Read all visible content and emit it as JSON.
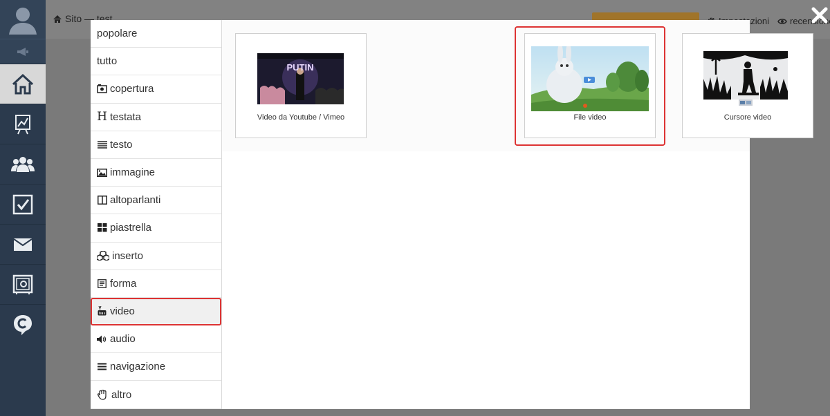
{
  "app_sidebar": {
    "items": [
      {
        "icon": "user-icon"
      },
      {
        "icon": "megaphone-icon"
      },
      {
        "icon": "home-icon"
      },
      {
        "icon": "chart-icon"
      },
      {
        "icon": "users-icon"
      },
      {
        "icon": "checkbox-icon"
      },
      {
        "icon": "mail-icon"
      },
      {
        "icon": "safe-icon"
      },
      {
        "icon": "chat-icon"
      }
    ]
  },
  "topbar": {
    "breadcrumb": "Sito — test",
    "settings_label": "Impostazioni",
    "review_label": "recensione"
  },
  "modal": {
    "categories": [
      {
        "label": "popolare",
        "icon": ""
      },
      {
        "label": "tutto",
        "icon": ""
      },
      {
        "label": "copertura",
        "icon": "camera-icon"
      },
      {
        "label": "testata",
        "icon": "header-icon"
      },
      {
        "label": "testo",
        "icon": "text-lines-icon"
      },
      {
        "label": "immagine",
        "icon": "image-icon"
      },
      {
        "label": "altoparlanti",
        "icon": "columns-icon"
      },
      {
        "label": "piastrella",
        "icon": "tiles-icon"
      },
      {
        "label": "inserto",
        "icon": "cubes-icon"
      },
      {
        "label": "forma",
        "icon": "form-icon"
      },
      {
        "label": "video",
        "icon": "youtube-icon"
      },
      {
        "label": "audio",
        "icon": "speaker-icon"
      },
      {
        "label": "navigazione",
        "icon": "bars-icon"
      },
      {
        "label": "altro",
        "icon": "hand-icon"
      }
    ],
    "selected_category": "video",
    "cards": [
      {
        "label": "Video da Youtube / Vimeo",
        "thumb_title": "PUTIN"
      },
      {
        "label": "File video"
      },
      {
        "label": "Cursore video"
      }
    ]
  },
  "colors": {
    "sidebar_bg": "#2b3a4d",
    "highlight": "#dd3333",
    "accent_button": "#a0742a"
  }
}
